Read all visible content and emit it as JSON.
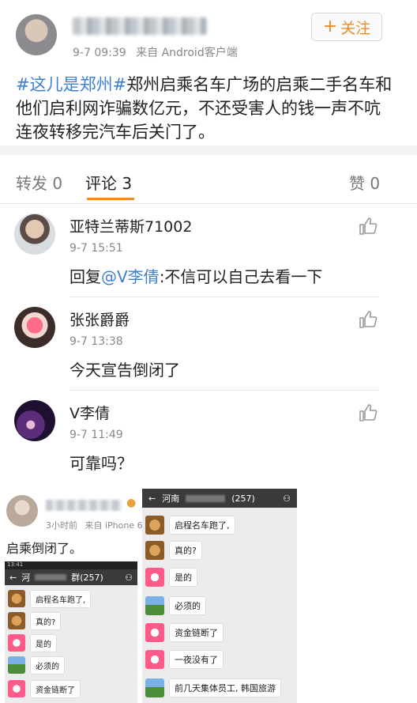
{
  "post": {
    "time": "9-7 09:39",
    "source": "来自 Android客户端",
    "follow_label": "关注",
    "hashtag": "#这儿是郑州#",
    "text": "郑州启乘名车广场的启乘二手名车和他们启利网诈骗数亿元，不还受害人的钱一声不吭连夜转移完汽车后关门了。"
  },
  "tabs": {
    "repost": "转发 0",
    "comment": "评论 3",
    "like": "赞 0"
  },
  "comments": [
    {
      "name": "亚特兰蒂斯71002",
      "time": "9-7 15:51",
      "reply_prefix": "回复",
      "mention": "@V李倩",
      "text": ":不信可以自己去看一下"
    },
    {
      "name": "张张爵爵",
      "time": "9-7 13:38",
      "text": "今天宣告倒闭了"
    },
    {
      "name": "V李倩",
      "time": "9-7 11:49",
      "text": "可靠吗？"
    }
  ],
  "subpost": {
    "time": "3小时前",
    "source": "来自 iPhone 6",
    "text": "启乘倒闭了。"
  },
  "chat_large": {
    "title": "河南",
    "count": "(257)",
    "messages": [
      "启程名车跑了,",
      "真的?",
      "是的",
      "必须的",
      "资金链断了",
      "一夜没有了",
      "前几天集体员工, 韩国旅游"
    ]
  },
  "chat_small": {
    "status_time": "13:41",
    "title": "河",
    "count": "群(257)",
    "messages": [
      "启程名车跑了,",
      "真的?",
      "是的",
      "必须的",
      "资金链断了"
    ]
  }
}
